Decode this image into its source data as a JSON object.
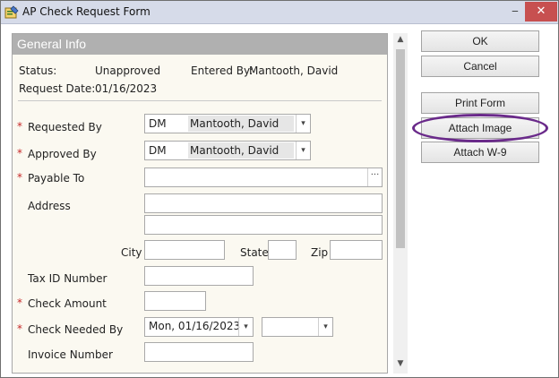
{
  "window": {
    "title": "AP Check Request Form",
    "minimize": "‒",
    "close": "✕"
  },
  "panel": {
    "title": "General Info"
  },
  "status": {
    "status_label": "Status:",
    "status_value": "Unapproved",
    "entered_by_label": "Entered By:",
    "entered_by_value": "Mantooth, David",
    "request_date_label": "Request Date:",
    "request_date_value": "01/16/2023"
  },
  "form": {
    "required_mark": "*",
    "requested_by": {
      "label": "Requested By",
      "code": "DM",
      "name": "Mantooth, David"
    },
    "approved_by": {
      "label": "Approved By",
      "code": "DM",
      "name": "Mantooth, David"
    },
    "payable_to": {
      "label": "Payable To",
      "value": "",
      "browse": "···"
    },
    "address": {
      "label": "Address",
      "line1": "",
      "line2": ""
    },
    "city": {
      "label": "City",
      "value": ""
    },
    "state": {
      "label": "State",
      "value": ""
    },
    "zip": {
      "label": "Zip",
      "value": ""
    },
    "tax_id": {
      "label": "Tax ID Number",
      "value": ""
    },
    "check_amount": {
      "label": "Check Amount",
      "value": ""
    },
    "check_needed_by": {
      "label": "Check Needed By",
      "date": "Mon, 01/16/2023",
      "time": ""
    },
    "invoice_number": {
      "label": "Invoice Number",
      "value": ""
    }
  },
  "buttons": {
    "ok": "OK",
    "cancel": "Cancel",
    "print_form": "Print Form",
    "attach_image": "Attach Image",
    "attach_w9": "Attach W-9"
  },
  "icons": {
    "dropdown": "▾",
    "scroll_up": "▲",
    "scroll_down": "▼"
  },
  "colors": {
    "required": "#c62828",
    "highlight_ellipse": "#6a2a8a",
    "close": "#c75050"
  }
}
